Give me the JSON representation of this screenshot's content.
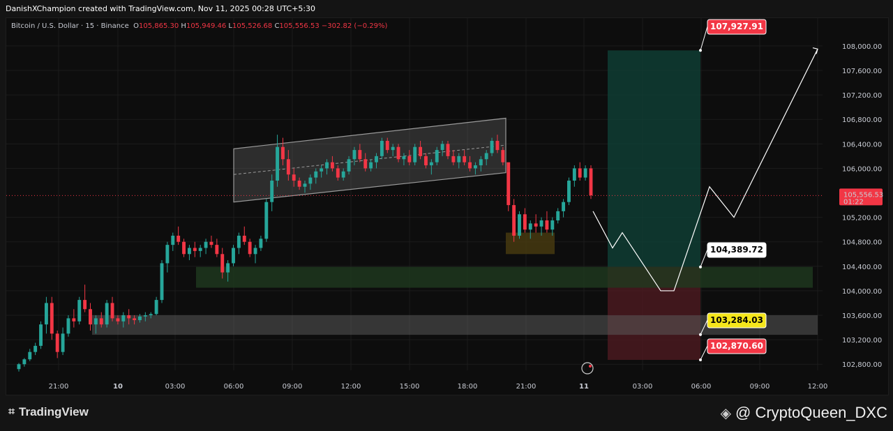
{
  "header": {
    "attribution": "DanishXChampion created with TradingView.com, Nov 11, 2025 00:28 UTC+5:30"
  },
  "legend": {
    "symbol": "Bitcoin / U.S. Dollar · 15 · Binance",
    "o_label": "O",
    "o_value": "105,865.30",
    "h_label": "H",
    "h_value": "105,949.46",
    "l_label": "L",
    "l_value": "105,526.68",
    "c_label": "C",
    "c_value": "105,556.53",
    "change": "−302.82 (−0.29%)"
  },
  "footer": {
    "brand": "TradingView",
    "user": "@ CryptoQueen_DXC"
  },
  "colors": {
    "up": "#26a69a",
    "down": "#f23645",
    "background": "#0d0d0d",
    "target_zone": "#0f3d34",
    "stop_zone": "#4a1a20",
    "support_zone": "#1f3a1f",
    "demand_zone": "#5a5a5a"
  },
  "chart_data": {
    "type": "candlestick",
    "symbol": "BTCUSD",
    "interval": "15",
    "ylim": [
      102700,
      108250
    ],
    "y_ticks": [
      "108,000.00",
      "107,600.00",
      "107,200.00",
      "106,800.00",
      "106,400.00",
      "106,000.00",
      "105,200.00",
      "104,800.00",
      "104,400.00",
      "104,000.00",
      "103,600.00",
      "103,200.00",
      "102,800.00"
    ],
    "x_ticks": [
      "21:00",
      "10",
      "03:00",
      "06:00",
      "09:00",
      "12:00",
      "15:00",
      "18:00",
      "21:00",
      "11",
      "03:00",
      "06:00",
      "09:00",
      "12:00"
    ],
    "current_price": "105,556.53",
    "countdown": "01:22",
    "price_labels": {
      "target": "107,927.91",
      "entry": "104,389.72",
      "support": "103,284.03",
      "stop": "102,870.60"
    },
    "candles": [
      [
        102720,
        102820,
        102680,
        102800
      ],
      [
        102800,
        102900,
        102760,
        102880
      ],
      [
        102880,
        103050,
        102850,
        103000
      ],
      [
        103000,
        103150,
        102950,
        103100
      ],
      [
        103100,
        103500,
        103050,
        103450
      ],
      [
        103450,
        103900,
        103300,
        103800
      ],
      [
        103800,
        103900,
        103200,
        103300
      ],
      [
        103300,
        103350,
        102900,
        103000
      ],
      [
        103000,
        103400,
        102950,
        103300
      ],
      [
        103300,
        103600,
        103250,
        103550
      ],
      [
        103550,
        103700,
        103400,
        103500
      ],
      [
        103500,
        103900,
        103450,
        103850
      ],
      [
        103850,
        104100,
        103650,
        103700
      ],
      [
        103700,
        103800,
        103350,
        103450
      ],
      [
        103450,
        103600,
        103300,
        103550
      ],
      [
        103550,
        103650,
        103400,
        103450
      ],
      [
        103450,
        103850,
        103400,
        103800
      ],
      [
        103800,
        103900,
        103500,
        103550
      ],
      [
        103550,
        103600,
        103450,
        103500
      ],
      [
        103500,
        103650,
        103400,
        103600
      ],
      [
        103600,
        103700,
        103450,
        103550
      ],
      [
        103550,
        103600,
        103450,
        103520
      ],
      [
        103520,
        103620,
        103480,
        103580
      ],
      [
        103580,
        103650,
        103500,
        103600
      ],
      [
        103600,
        103650,
        103550,
        103620
      ],
      [
        103620,
        103900,
        103600,
        103850
      ],
      [
        103850,
        104500,
        103800,
        104450
      ],
      [
        104450,
        104800,
        104300,
        104750
      ],
      [
        104750,
        104950,
        104650,
        104900
      ],
      [
        104900,
        105050,
        104750,
        104800
      ],
      [
        104800,
        104850,
        104550,
        104600
      ],
      [
        104600,
        104750,
        104500,
        104700
      ],
      [
        104700,
        104800,
        104550,
        104650
      ],
      [
        104650,
        104750,
        104550,
        104700
      ],
      [
        104700,
        104850,
        104600,
        104800
      ],
      [
        104800,
        104900,
        104700,
        104750
      ],
      [
        104750,
        104850,
        104550,
        104600
      ],
      [
        104600,
        104700,
        104200,
        104300
      ],
      [
        104300,
        104500,
        104150,
        104450
      ],
      [
        104450,
        104750,
        104400,
        104700
      ],
      [
        104700,
        104950,
        104600,
        104900
      ],
      [
        104900,
        105050,
        104750,
        104800
      ],
      [
        104800,
        104850,
        104550,
        104600
      ],
      [
        104600,
        104750,
        104450,
        104700
      ],
      [
        104700,
        104900,
        104650,
        104850
      ],
      [
        104850,
        105500,
        104800,
        105450
      ],
      [
        105450,
        105900,
        105300,
        105800
      ],
      [
        105800,
        106550,
        105700,
        106350
      ],
      [
        106350,
        106500,
        106050,
        106150
      ],
      [
        106150,
        106300,
        105800,
        105900
      ],
      [
        105900,
        106000,
        105700,
        105800
      ],
      [
        105800,
        105850,
        105650,
        105700
      ],
      [
        105700,
        105800,
        105600,
        105750
      ],
      [
        105750,
        105900,
        105650,
        105850
      ],
      [
        105850,
        106000,
        105750,
        105950
      ],
      [
        105950,
        106050,
        105850,
        106000
      ],
      [
        106000,
        106150,
        105900,
        106100
      ],
      [
        106100,
        106200,
        105950,
        106000
      ],
      [
        106000,
        106050,
        105800,
        105850
      ],
      [
        105850,
        106000,
        105800,
        105950
      ],
      [
        105950,
        106200,
        105900,
        106150
      ],
      [
        106150,
        106350,
        106050,
        106300
      ],
      [
        106300,
        106400,
        106100,
        106150
      ],
      [
        106150,
        106250,
        105950,
        106000
      ],
      [
        106000,
        106150,
        105950,
        106100
      ],
      [
        106100,
        106250,
        106000,
        106200
      ],
      [
        106200,
        106500,
        106150,
        106450
      ],
      [
        106450,
        106500,
        106250,
        106300
      ],
      [
        106300,
        106400,
        106200,
        106350
      ],
      [
        106350,
        106400,
        106100,
        106150
      ],
      [
        106150,
        106250,
        106050,
        106200
      ],
      [
        106200,
        106300,
        106050,
        106100
      ],
      [
        106100,
        106400,
        106050,
        106350
      ],
      [
        106350,
        106450,
        106150,
        106200
      ],
      [
        106200,
        106250,
        106000,
        106050
      ],
      [
        106050,
        106150,
        105900,
        106100
      ],
      [
        106100,
        106350,
        106050,
        106300
      ],
      [
        106300,
        106450,
        106200,
        106400
      ],
      [
        106400,
        106450,
        106150,
        106200
      ],
      [
        106200,
        106300,
        106050,
        106100
      ],
      [
        106100,
        106250,
        106000,
        106200
      ],
      [
        106200,
        106300,
        106050,
        106100
      ],
      [
        106100,
        106200,
        105950,
        106000
      ],
      [
        106000,
        106100,
        105900,
        106050
      ],
      [
        106050,
        106200,
        105950,
        106150
      ],
      [
        106150,
        106300,
        106050,
        106250
      ],
      [
        106250,
        106500,
        106200,
        106450
      ],
      [
        106450,
        106550,
        106250,
        106300
      ],
      [
        106300,
        106350,
        106050,
        106100
      ],
      [
        106100,
        105500,
        105300,
        105400
      ],
      [
        105400,
        105500,
        104800,
        104900
      ],
      [
        104900,
        105300,
        104850,
        105250
      ],
      [
        105250,
        105350,
        104950,
        105000
      ],
      [
        105000,
        105150,
        104850,
        105100
      ],
      [
        105100,
        105250,
        104950,
        105050
      ],
      [
        105050,
        105200,
        104900,
        105150
      ],
      [
        105150,
        105300,
        104950,
        105000
      ],
      [
        105000,
        105200,
        104900,
        105150
      ],
      [
        105150,
        105350,
        105100,
        105300
      ],
      [
        105300,
        105500,
        105200,
        105450
      ],
      [
        105450,
        105850,
        105400,
        105800
      ],
      [
        105800,
        106050,
        105700,
        106000
      ],
      [
        106000,
        106100,
        105800,
        105850
      ],
      [
        105850,
        106050,
        105800,
        106000
      ],
      [
        106000,
        106050,
        105500,
        105560
      ]
    ],
    "projection": [
      [
        0,
        105300
      ],
      [
        1,
        104700
      ],
      [
        2,
        104950
      ],
      [
        3,
        104000
      ],
      [
        4,
        104000
      ],
      [
        5,
        105700
      ],
      [
        6,
        105200
      ],
      [
        7,
        107950
      ]
    ]
  }
}
